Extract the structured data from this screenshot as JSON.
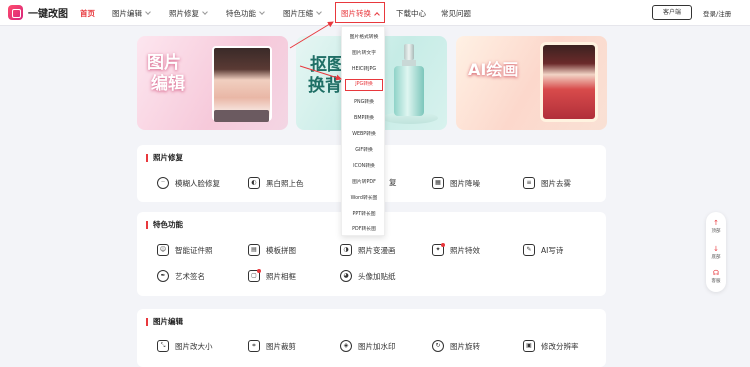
{
  "brand": {
    "name": "一键改图"
  },
  "nav": {
    "items": [
      {
        "label": "首页"
      },
      {
        "label": "图片编辑"
      },
      {
        "label": "照片修复"
      },
      {
        "label": "特色功能"
      },
      {
        "label": "图片压缩"
      },
      {
        "label": "图片转换"
      },
      {
        "label": "下载中心"
      },
      {
        "label": "常见问题"
      }
    ],
    "client_button": "客户端",
    "login": "登录/注册"
  },
  "dropdown": {
    "items": [
      "图片格式转换",
      "图片转文字",
      "HEIC转JPG",
      "JPG转换",
      "PNG转换",
      "BMP转换",
      "WEBP转换",
      "GIF转换",
      "ICON转换",
      "图片转PDF",
      "Word转长图",
      "PPT转长图",
      "PDF转长图"
    ],
    "highlighted": "JPG转换"
  },
  "banners": {
    "b1": {
      "line1": "图片",
      "line2": "编辑"
    },
    "b2": {
      "line1": "抠图",
      "line2": "换背"
    },
    "b3": {
      "title": "AI绘画"
    }
  },
  "sections": {
    "repair": {
      "title": "照片修复",
      "tools": [
        "模糊人脸修复",
        "黑白照上色",
        "复",
        "图片降噪",
        "图片去雾"
      ]
    },
    "special": {
      "title": "特色功能",
      "tools": [
        "智能证件照",
        "模板拼图",
        "照片变漫画",
        "照片特效",
        "AI写诗",
        "艺术签名",
        "照片相框",
        "头像加贴纸"
      ]
    },
    "edit": {
      "title": "图片编辑",
      "tools": [
        "图片改大小",
        "图片裁剪",
        "图片加水印",
        "图片旋转",
        "修改分辨率"
      ]
    }
  },
  "float_bar": {
    "items": [
      "顶部",
      "底部",
      "客服"
    ]
  },
  "colors": {
    "accent": "#e8383d"
  }
}
